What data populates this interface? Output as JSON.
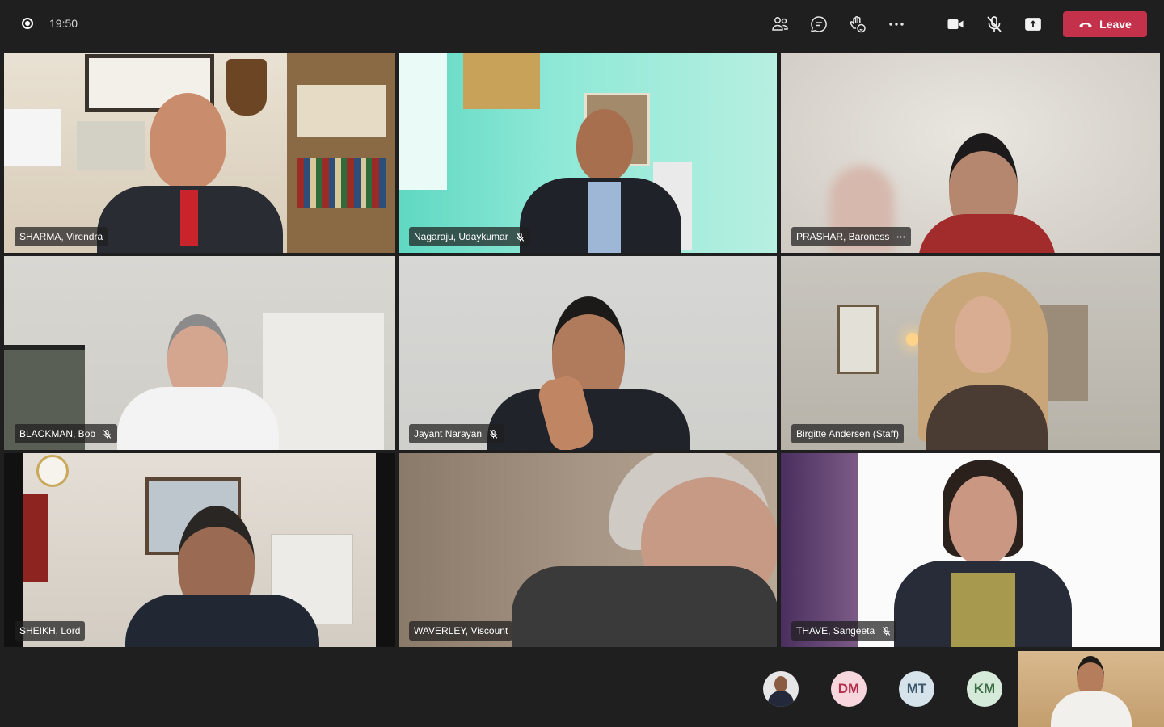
{
  "call": {
    "timer": "19:50"
  },
  "toolbar": {
    "participants_icon": "people-icon",
    "chat_icon": "chat-icon",
    "reactions_icon": "raise-hand-icon",
    "more_icon": "more-icon",
    "camera_icon": "camera-icon",
    "mic_icon": "mic-off-icon",
    "share_icon": "share-screen-icon",
    "leave_label": "Leave",
    "leave_color": "#c4314b"
  },
  "participants": [
    {
      "name": "SHARMA, Virendra",
      "muted": false,
      "more": false
    },
    {
      "name": "Nagaraju, Udaykumar",
      "muted": true,
      "more": false
    },
    {
      "name": "PRASHAR, Baroness",
      "muted": false,
      "more": true
    },
    {
      "name": "BLACKMAN, Bob",
      "muted": true,
      "more": false
    },
    {
      "name": "Jayant Narayan",
      "muted": true,
      "more": false
    },
    {
      "name": "Birgitte Andersen (Staff)",
      "muted": false,
      "more": false
    },
    {
      "name": "SHEIKH, Lord",
      "muted": false,
      "more": false
    },
    {
      "name": "WAVERLEY, Viscount",
      "muted": false,
      "more": false
    },
    {
      "name": "THAVE, Sangeeta",
      "muted": true,
      "more": false
    }
  ],
  "roster": [
    {
      "initials": "",
      "type": "photo"
    },
    {
      "initials": "DM",
      "bg": "#f7d6de",
      "fg": "#b5304d"
    },
    {
      "initials": "MT",
      "bg": "#d7e3ea",
      "fg": "#3c5a6e"
    },
    {
      "initials": "KM",
      "bg": "#d6ead9",
      "fg": "#3c6e48"
    }
  ]
}
